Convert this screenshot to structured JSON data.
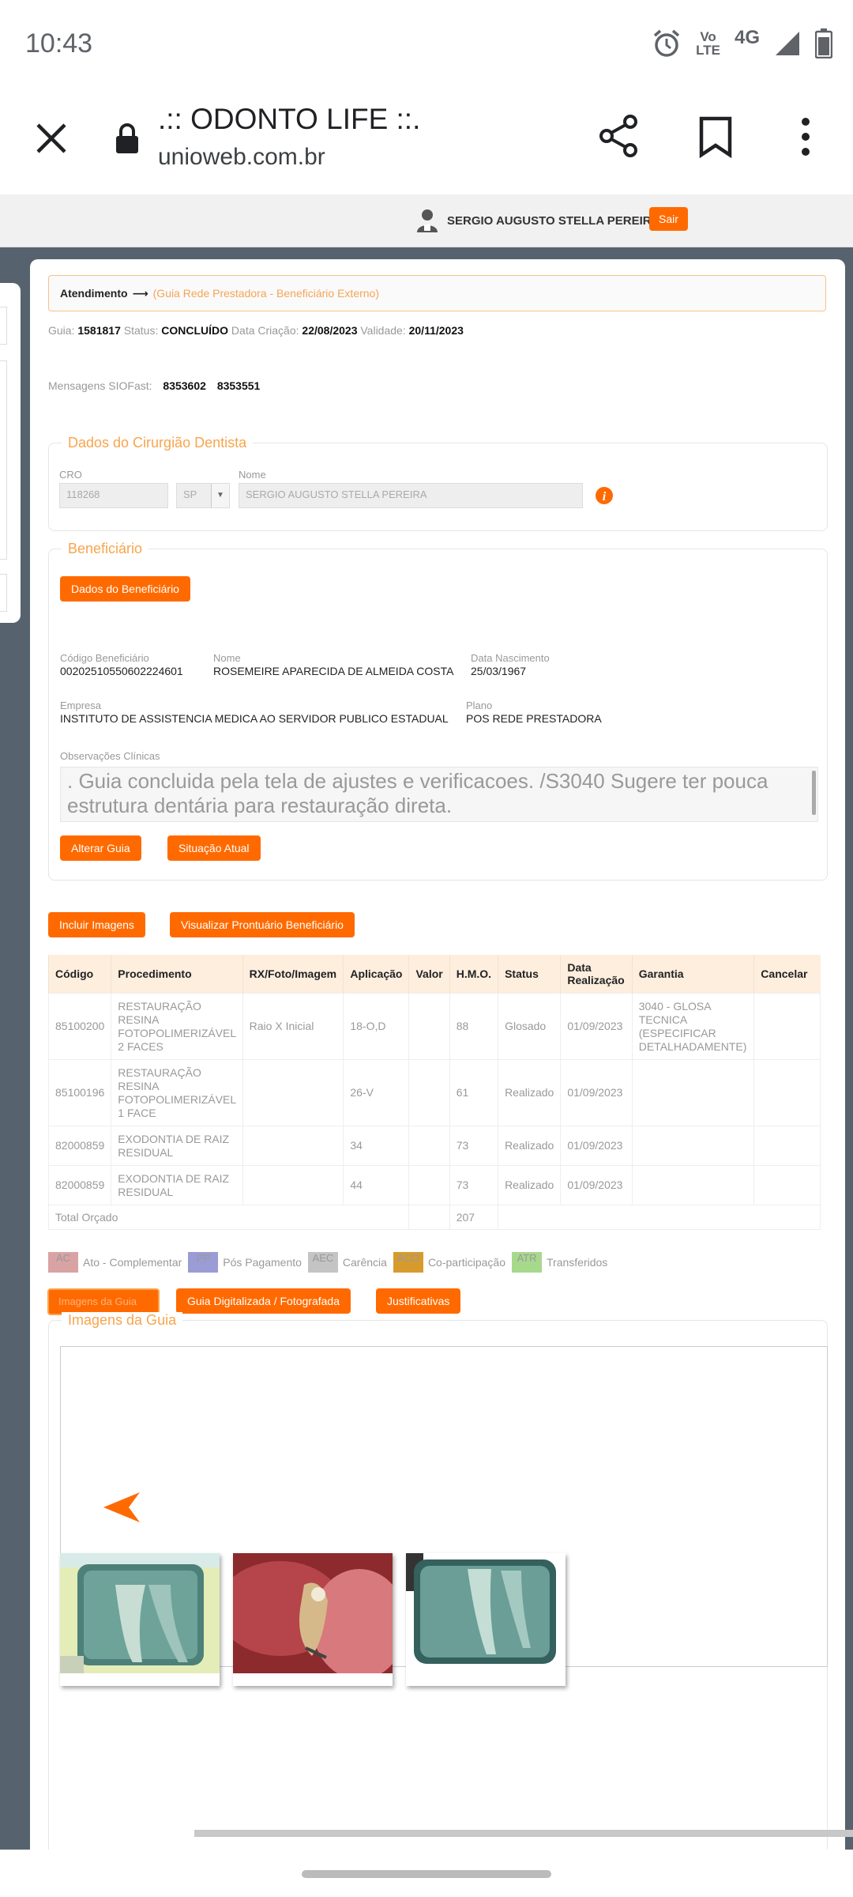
{
  "status_bar": {
    "time": "10:43",
    "volte_top": "Vo",
    "volte_bottom": "LTE",
    "network": "4G"
  },
  "browser": {
    "title": ".:: ODONTO LIFE ::.",
    "url": "unioweb.com.br"
  },
  "header": {
    "user_name": "SERGIO AUGUSTO STELLA PEREIRA",
    "logout_label": "Sair"
  },
  "breadcrumb": {
    "current": "Atendimento",
    "link": "(Guia Rede Prestadora - Beneficiário Externo)"
  },
  "guia": {
    "guia_label": "Guia:",
    "guia_value": "1581817",
    "status_label": "Status:",
    "status_value": "CONCLUÍDO",
    "created_label": "Data Criação:",
    "created_value": "22/08/2023",
    "valid_label": "Validade:",
    "valid_value": "20/11/2023",
    "messages_label": "Mensagens SIOFast:",
    "messages": [
      "8353602",
      "8353551"
    ]
  },
  "dentist": {
    "legend": "Dados do Cirurgião Dentista",
    "cro_label": "CRO",
    "cro_value": "118268",
    "uf_value": "SP",
    "name_label": "Nome",
    "name_value": "SERGIO AUGUSTO STELLA PEREIRA"
  },
  "beneficiary": {
    "legend": "Beneficiário",
    "data_button": "Dados do Beneficiário",
    "code_label": "Código Beneficiário",
    "code_value": "00202510550602224601",
    "name_label": "Nome",
    "name_value": "ROSEMEIRE APARECIDA DE ALMEIDA COSTA",
    "birth_label": "Data Nascimento",
    "birth_value": "25/03/1967",
    "company_label": "Empresa",
    "company_value": "INSTITUTO DE ASSISTENCIA MEDICA AO SERVIDOR PUBLICO ESTADUAL",
    "plan_label": "Plano",
    "plan_value": "POS REDE PRESTADORA",
    "obs_label": "Observações Clínicas",
    "obs_text": ". Guia concluida pela tela de ajustes e verificacoes. /S3040 Sugere ter pouca estrutura dentária para restauração direta.",
    "alter_button": "Alterar Guia",
    "situation_button": "Situação Atual"
  },
  "actions": {
    "include_images": "Incluir Imagens",
    "view_record": "Visualizar Prontuário Beneficiário"
  },
  "procedures": {
    "headers": [
      "Código",
      "Procedimento",
      "RX/Foto/Imagem",
      "Aplicação",
      "Valor",
      "H.M.O.",
      "Status",
      "Data Realização",
      "Garantia",
      "Cancelar"
    ],
    "rows": [
      [
        "85100200",
        "RESTAURAÇÃO RESINA FOTOPOLIMERIZÁVEL 2 FACES",
        "Raio X Inicial",
        "18-O,D",
        "",
        "88",
        "Glosado",
        "01/09/2023",
        "3040 - GLOSA TECNICA (ESPECIFICAR DETALHADAMENTE)",
        ""
      ],
      [
        "85100196",
        "RESTAURAÇÃO RESINA FOTOPOLIMERIZÁVEL 1 FACE",
        "",
        "26-V",
        "",
        "61",
        "Realizado",
        "01/09/2023",
        "",
        ""
      ],
      [
        "82000859",
        "EXODONTIA DE RAIZ RESIDUAL",
        "",
        "34",
        "",
        "73",
        "Realizado",
        "01/09/2023",
        "",
        ""
      ],
      [
        "82000859",
        "EXODONTIA DE RAIZ RESIDUAL",
        "",
        "44",
        "",
        "73",
        "Realizado",
        "01/09/2023",
        "",
        ""
      ]
    ],
    "total_label": "Total Orçado",
    "total_value": "207"
  },
  "legend": [
    {
      "code": "AC",
      "label": "Ato - Complementar",
      "color": "#d9a3a3"
    },
    {
      "code": "PP",
      "label": "Pós Pagamento",
      "color": "#9b9bd6"
    },
    {
      "code": "AEC",
      "label": "Carência",
      "color": "#c4c4c4"
    },
    {
      "code": "ACO",
      "label": "Co-participação",
      "color": "#d79b2d"
    },
    {
      "code": "ATR",
      "label": "Transferidos",
      "color": "#a7d98d"
    }
  ],
  "tabs": {
    "images_tab": "Imagens da Guia",
    "scanned_tab": "Guia Digitalizada / Fotografada",
    "justify_tab": "Justificativas"
  },
  "images_panel": {
    "legend": "Imagens da Guia"
  },
  "colors": {
    "accent": "#ff6a00",
    "legend_orange": "#f7a54d",
    "page_bg": "#56636e"
  }
}
